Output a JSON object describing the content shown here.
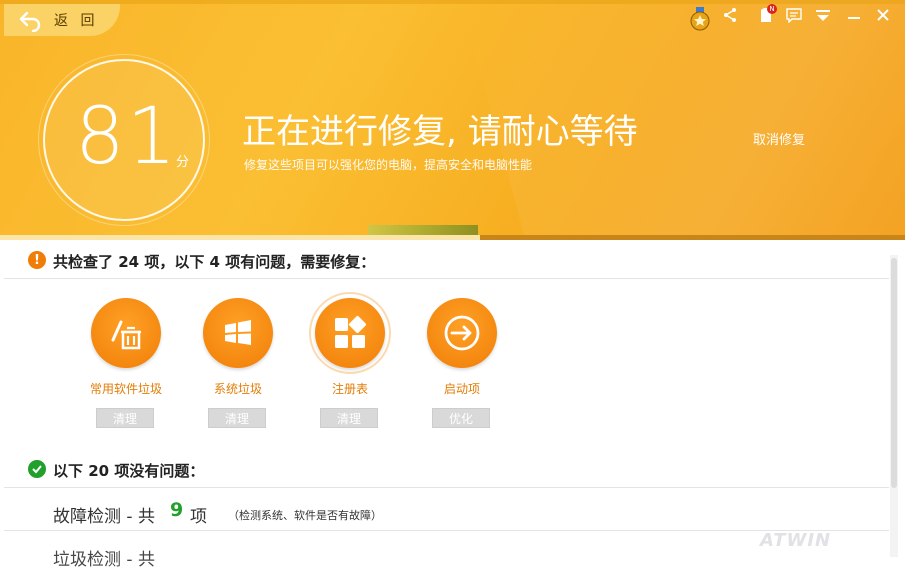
{
  "header": {
    "back_label": "返 回",
    "score": "81",
    "score_unit": "分",
    "title": "正在进行修复, 请耐心等待",
    "subtitle": "修复这些项目可以强化您的电脑，提高安全和电脑性能",
    "cancel_label": "取消修复",
    "progress_percent": 53,
    "notification_badge": "N"
  },
  "problems": {
    "title": "共检查了 24 项，以下 4 项有问题，需要修复：",
    "items": [
      {
        "label": "常用软件垃圾",
        "action": "清理",
        "icon": "software-trash-icon"
      },
      {
        "label": "系统垃圾",
        "action": "清理",
        "icon": "windows-icon"
      },
      {
        "label": "注册表",
        "action": "清理",
        "icon": "registry-icon"
      },
      {
        "label": "启动项",
        "action": "优化",
        "icon": "startup-arrow-icon"
      }
    ]
  },
  "ok": {
    "title": "以下 20 项没有问题：",
    "categories": [
      {
        "name": "故障检测 - 共",
        "count": "9",
        "unit": "项",
        "desc": "（检测系统、软件是否有故障）"
      },
      {
        "name": "垃圾检测 - 共"
      }
    ]
  },
  "watermark": "ATWIN",
  "colors": {
    "accent": "#f39d16",
    "ok_green": "#21a02c",
    "warn_orange": "#f07d07"
  }
}
